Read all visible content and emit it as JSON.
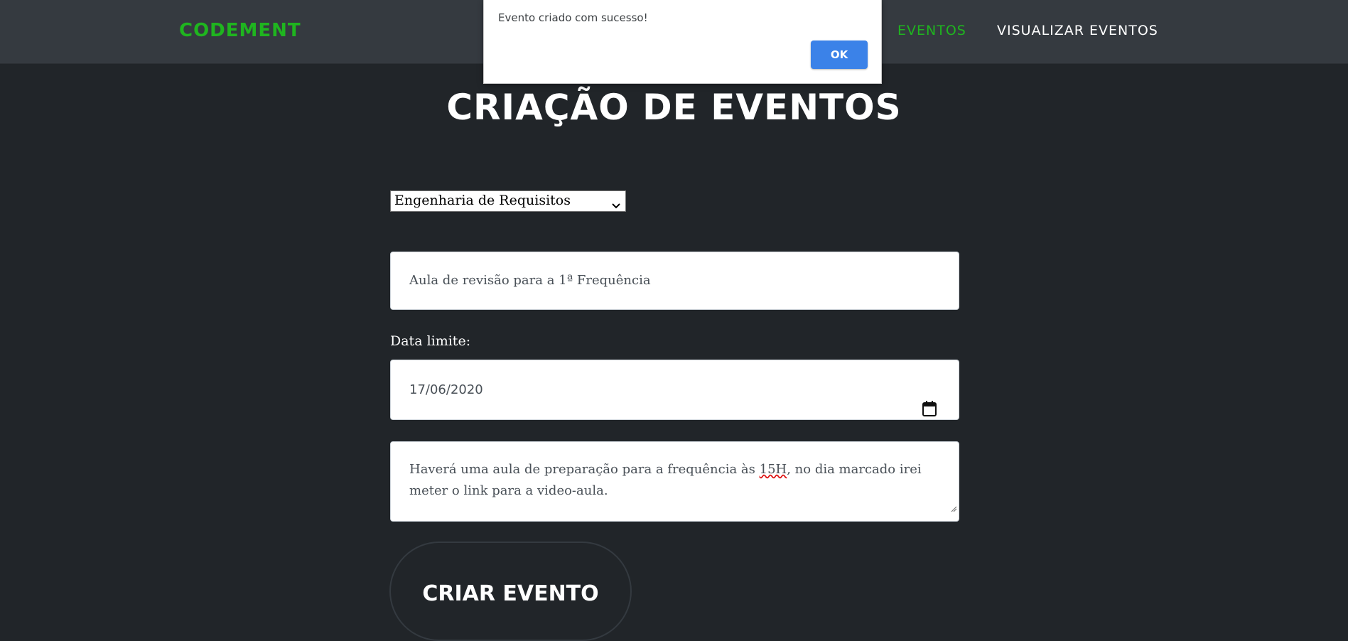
{
  "navbar": {
    "brand": "CODEMENT",
    "links": [
      {
        "label": "EVENTOS",
        "active": true
      },
      {
        "label": "VISUALIZAR EVENTOS",
        "active": false
      }
    ]
  },
  "page": {
    "title": "CRIAÇÃO DE EVENTOS"
  },
  "form": {
    "subject_select": {
      "selected": "Engenharia de Requisitos"
    },
    "title_input": {
      "value": "Aula de revisão para a 1ª Frequência"
    },
    "date_label": "Data limite:",
    "date_input": {
      "value": "17/06/2020"
    },
    "description": {
      "before": "Haverá uma aula de preparação para a frequência às ",
      "misspelled": "15H",
      "after": ",  no dia marcado irei meter o link para a video-aula."
    },
    "submit_label": "CRIAR EVENTO"
  },
  "alert": {
    "message": "Evento criado com sucesso!",
    "ok_label": "OK"
  },
  "colors": {
    "background": "#212529",
    "navbar": "#353a40",
    "accent_green": "#1fb51f",
    "ok_button": "#3b82e8"
  },
  "icons": {
    "select_arrow": "chevron-down-icon",
    "date_picker": "calendar-icon",
    "resize": "resize-grip-icon"
  }
}
